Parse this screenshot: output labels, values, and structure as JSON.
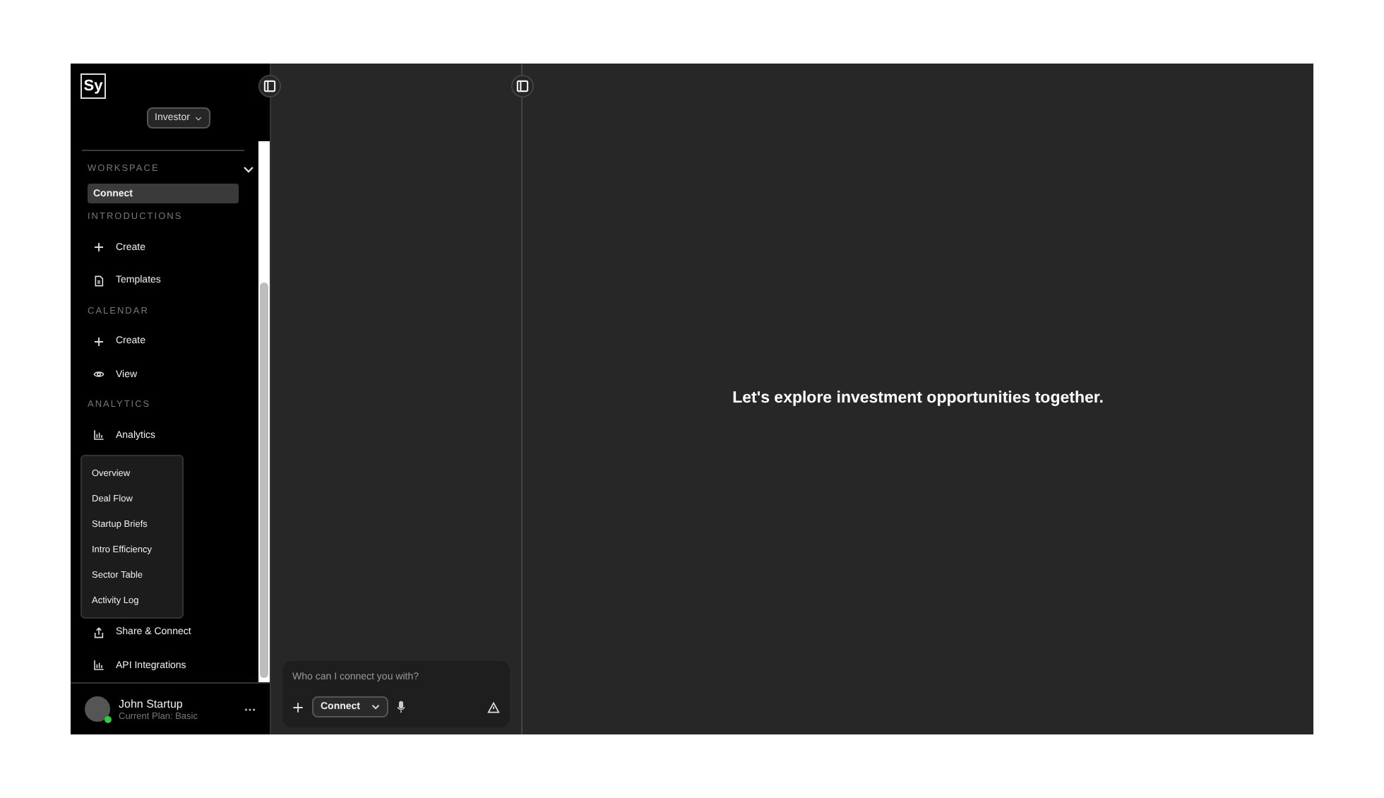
{
  "sidebar": {
    "logo": "Sy",
    "role_selector": "Investor",
    "sections": [
      {
        "label": "WORKSPACE",
        "expanded": true,
        "items": [
          {
            "label": "Connect",
            "kind": "plain",
            "selected": true
          }
        ]
      },
      {
        "label": "INTRODUCTIONS",
        "items": [
          {
            "label": "Create",
            "kind": "create",
            "selected": false
          },
          {
            "label": "Templates",
            "kind": "document",
            "selected": false
          }
        ]
      },
      {
        "label": "CALENDAR",
        "items": [
          {
            "label": "Create",
            "kind": "create",
            "selected": false
          },
          {
            "label": "View",
            "kind": "view",
            "selected": false
          }
        ]
      },
      {
        "label": "ANALYTICS",
        "items": [
          {
            "label": "Analytics",
            "kind": "chart",
            "selected": false,
            "expanded": true,
            "children": [
              {
                "label": "Overview"
              },
              {
                "label": "Deal Flow"
              },
              {
                "label": "Startup Briefs"
              },
              {
                "label": "Intro Efficiency"
              },
              {
                "label": "Sector Table"
              },
              {
                "label": "Activity Log"
              }
            ]
          },
          {
            "label": "Share & Connect",
            "kind": "share",
            "selected": false
          },
          {
            "label": "API Integrations",
            "kind": "chart",
            "selected": false
          }
        ]
      }
    ],
    "user": {
      "name": "John Startup",
      "plan": "Current Plan: Basic",
      "online": true
    }
  },
  "composer": {
    "placeholder": "Who can I connect you with?",
    "mode": "Connect"
  },
  "main": {
    "message": "Let's explore investment opportunities together."
  }
}
